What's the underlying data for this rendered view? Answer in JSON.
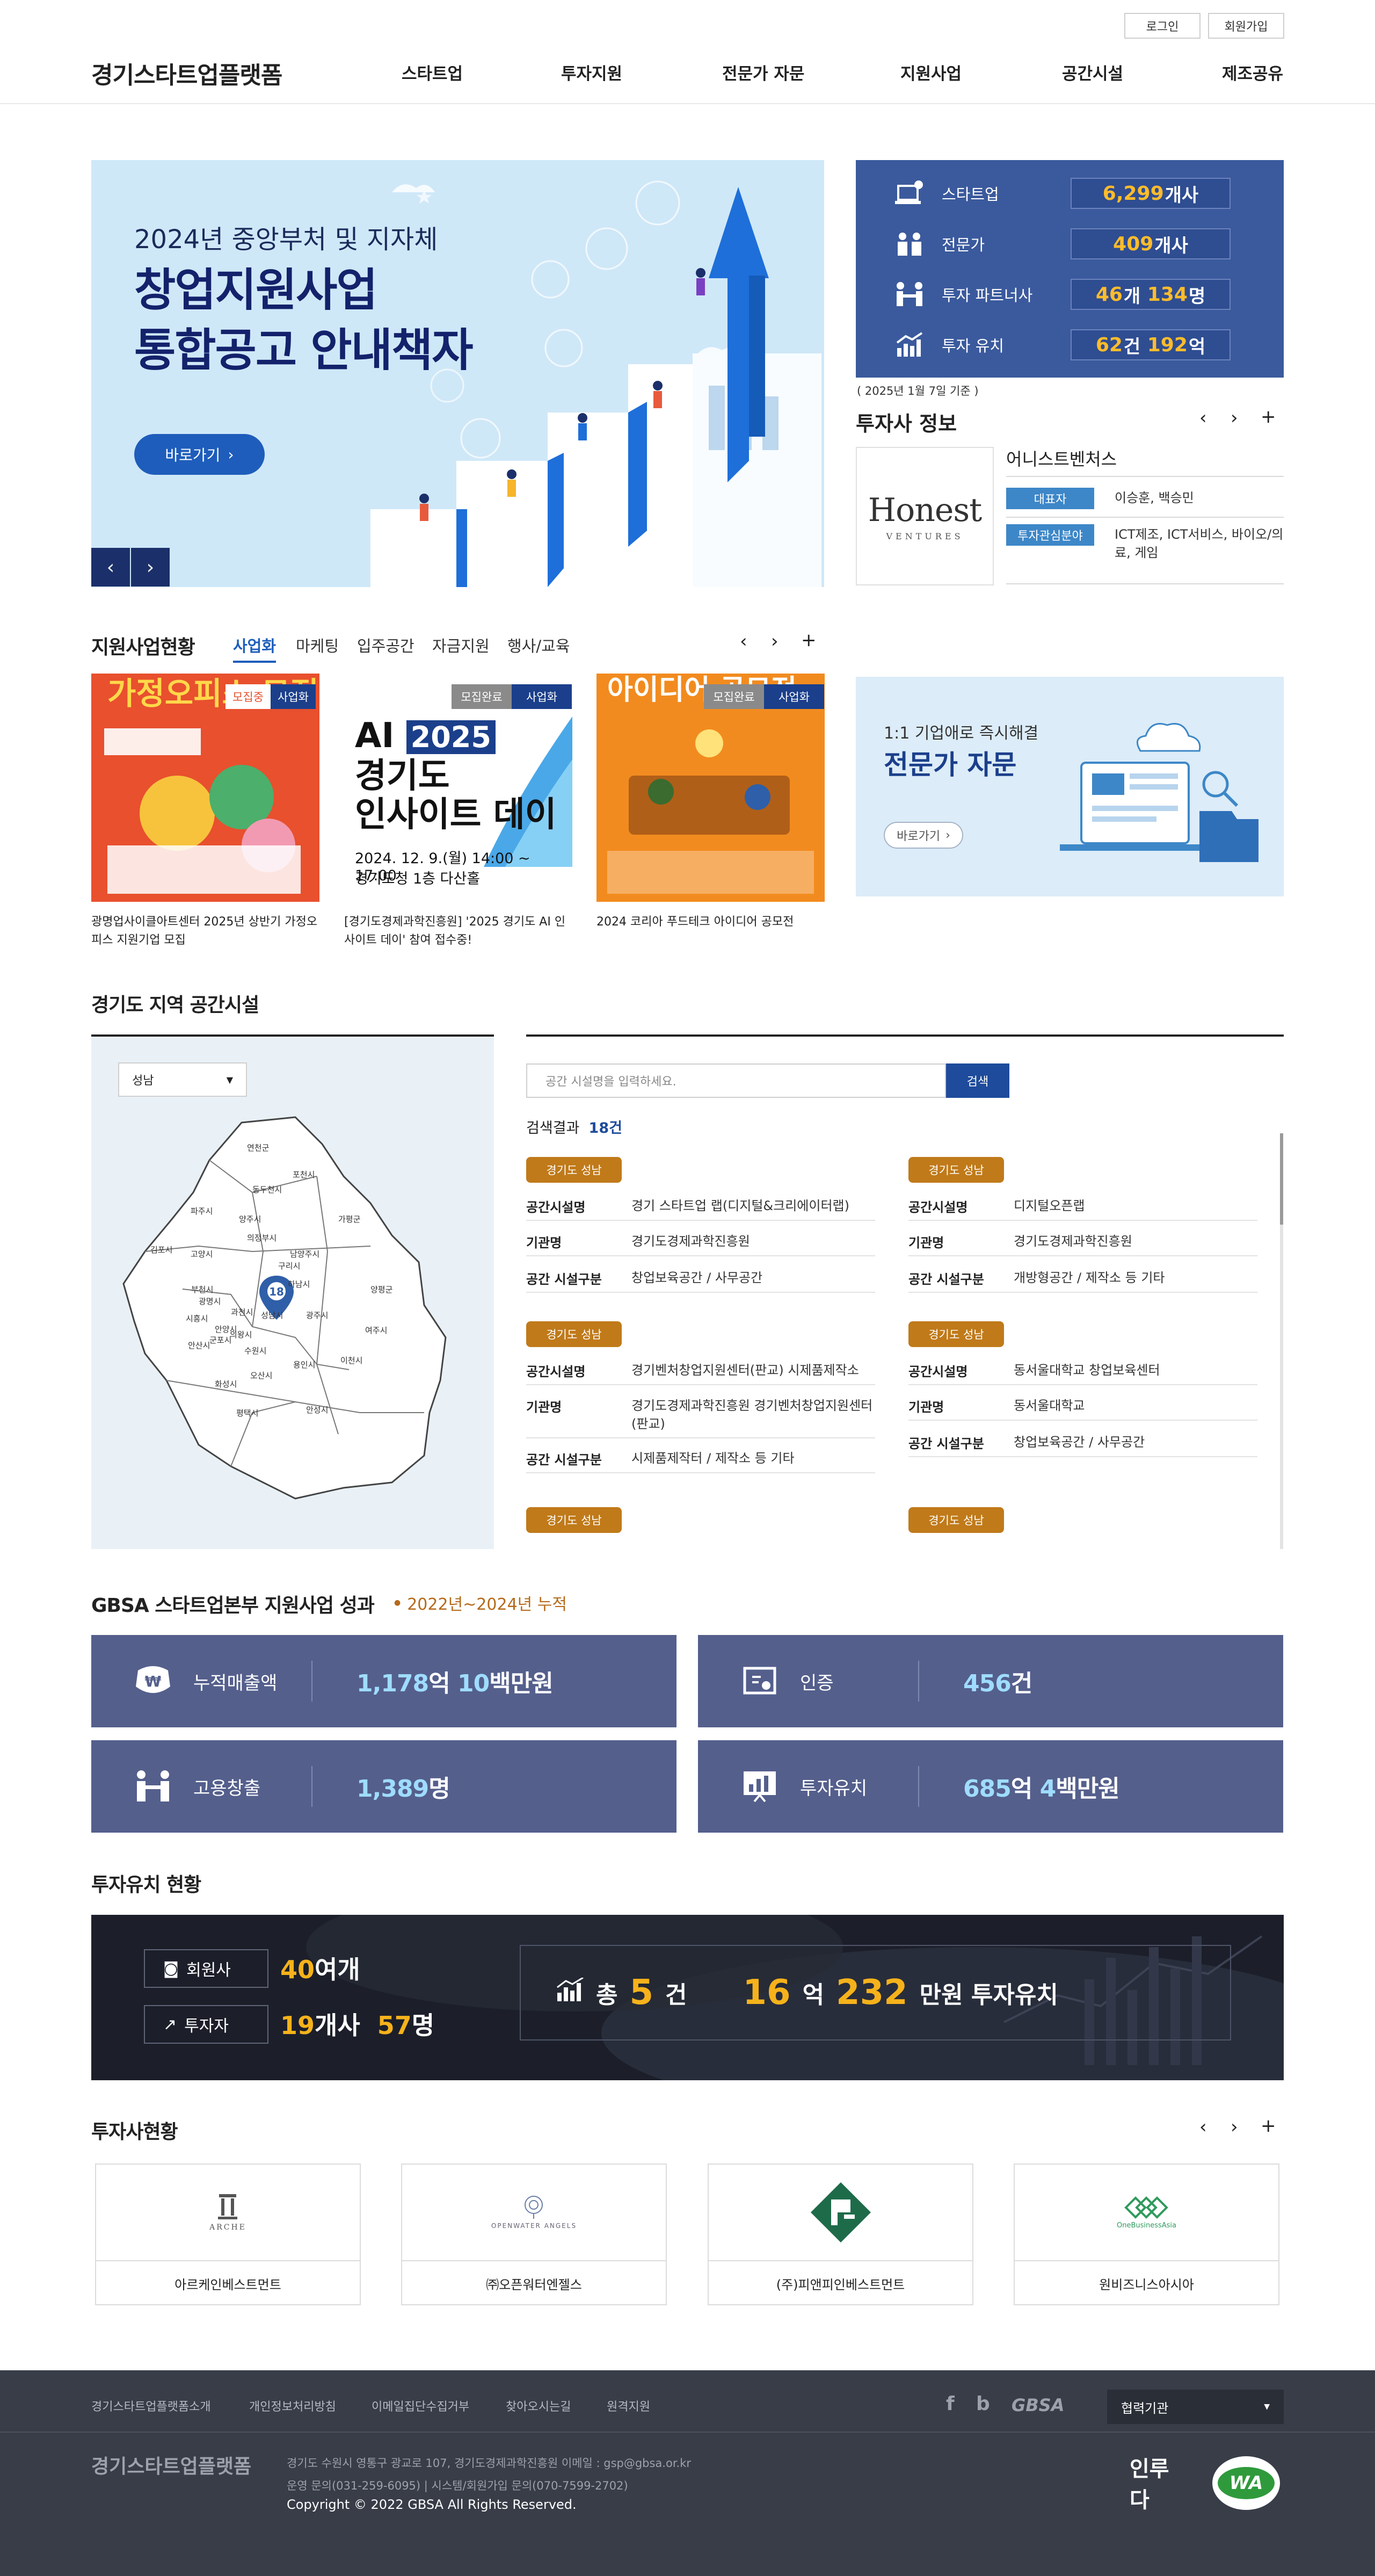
{
  "header": {
    "logo": "경기스타트업플랫폼",
    "login": "로그인",
    "join": "회원가입",
    "nav": [
      "스타트업",
      "투자지원",
      "전문가 자문",
      "지원사업",
      "공간시설",
      "제조공유"
    ]
  },
  "hero": {
    "subtitle": "2024년 중앙부처 및 지자체",
    "title_line1": "창업지원사업",
    "title_line2": "통합공고 안내책자",
    "button": "바로가기",
    "prev": "‹",
    "next": "›"
  },
  "stats": {
    "items": [
      {
        "label": "스타트업",
        "v1": "6,299",
        "u1": "개사",
        "icon": "startup-icon"
      },
      {
        "label": "전문가",
        "v1": "409",
        "u1": "개사",
        "icon": "expert-icon"
      },
      {
        "label": "투자 파트너사",
        "v1": "46",
        "u1": "개",
        "v2": "134",
        "u2": "명",
        "icon": "partner-icon"
      },
      {
        "label": "투자 유치",
        "v1": "62",
        "u1": "건",
        "v2": "192",
        "u2": "억",
        "icon": "investment-icon"
      }
    ],
    "note": "( 2025년 1월 7일 기준 )"
  },
  "investor_info": {
    "title": "투자사 정보",
    "logo_text": "Honest",
    "logo_sub": "VENTURES",
    "name": "어니스트벤처스",
    "ceo_label": "대표자",
    "ceo": "이승훈, 백승민",
    "field_label": "투자관심분야",
    "field": "ICT제조, ICT서비스, 바이오/의료, 게임"
  },
  "controls": {
    "prev": "‹",
    "next": "›",
    "more": "+"
  },
  "support": {
    "title": "지원사업현황",
    "tabs": [
      "사업화",
      "마케팅",
      "입주공간",
      "자금지원",
      "행사/교육"
    ],
    "cards": [
      {
        "img_title": "가정오피스 모집",
        "status": "모집중",
        "category": "사업화",
        "caption": "광명업사이클아트센터 2025년 상반기 가정오피스 지원기업 모집"
      },
      {
        "img_title_1": "AI",
        "img_title_2": "2025",
        "img_title_3": "경기도",
        "img_title_4": "인사이트 데이",
        "img_date": "2024. 12. 9.(월) 14:00 ~ 17:00",
        "img_place": "경기도청 1층 다산홀",
        "status": "모집완료",
        "category": "사업화",
        "caption": "[경기도경제과학진흥원] '2025 경기도 AI 인사이트 데이' 참여 접수중!"
      },
      {
        "img_title": "아이디어 공모전",
        "status": "모집완료",
        "category": "사업화",
        "caption": "2024 코리아 푸드테크 아이디어 공모전"
      }
    ],
    "expert": {
      "sub": "1:1 기업애로 즉시해결",
      "title": "전문가 자문",
      "button": "바로가기"
    }
  },
  "space": {
    "title": "경기도 지역 공간시설",
    "region_select": "성남",
    "map_count": "18",
    "map_labels": [
      "연천군",
      "포천시",
      "파주시",
      "동두천시",
      "양주시",
      "가평군",
      "의정부시",
      "고양시",
      "남양주시",
      "김포시",
      "구리시",
      "양평군",
      "하남시",
      "광명시",
      "과천시",
      "성남시",
      "시흥시",
      "안양시",
      "광주시",
      "의왕시",
      "여주시",
      "군포시",
      "안산시",
      "수원시",
      "용인시",
      "이천시",
      "오산시",
      "화성시",
      "평택시",
      "안성시",
      "부천시"
    ],
    "search_placeholder": "공간 시설명을 입력하세요.",
    "search_button": "검색",
    "result_label": "검색결과",
    "result_count": "18건",
    "key_name": "공간시설명",
    "key_org": "기관명",
    "key_type": "공간 시설구분",
    "results": [
      {
        "region": "경기도 성남",
        "name": "경기 스타트업 랩(디지털&크리에이터랩)",
        "org": "경기도경제과학진흥원",
        "type": "창업보육공간 / 사무공간"
      },
      {
        "region": "경기도 성남",
        "name": "디지털오픈랩",
        "org": "경기도경제과학진흥원",
        "type": "개방형공간 / 제작소 등 기타"
      },
      {
        "region": "경기도 성남",
        "name": "경기벤처창업지원센터(판교) 시제품제작소",
        "org": "경기도경제과학진흥원 경기벤처창업지원센터(판교)",
        "type": "시제품제작터 / 제작소 등 기타"
      },
      {
        "region": "경기도 성남",
        "name": "동서울대학교 창업보육센터",
        "org": "동서울대학교",
        "type": "창업보육공간 / 사무공간"
      },
      {
        "region": "경기도 성남"
      },
      {
        "region": "경기도 성남"
      }
    ]
  },
  "gbsa": {
    "title": "GBSA 스타트업본부 지원사업 성과",
    "period": "2022년~2024년 누적",
    "cards": [
      {
        "label": "누적매출액",
        "n1": "1,178",
        "u1": "억 ",
        "n2": "10",
        "u2": "백만원",
        "icon": "won-icon"
      },
      {
        "label": "인증",
        "n1": "456",
        "u1": "건",
        "icon": "certificate-icon"
      },
      {
        "label": "고용창출",
        "n1": "1,389",
        "u1": "명",
        "icon": "people-icon"
      },
      {
        "label": "투자유치",
        "n1": "685",
        "u1": "억 ",
        "n2": "4",
        "u2": "백만원",
        "icon": "chart-board-icon"
      }
    ]
  },
  "invest_status": {
    "title": "투자유치 현황",
    "member_label": "회원사",
    "member_n": "40",
    "member_u": "여개",
    "investor_label": "투자자",
    "investor_n1": "19",
    "investor_u1": "개사",
    "investor_n2": "57",
    "investor_u2": "명",
    "total_prefix": "총",
    "total_n": "5",
    "total_u": "건",
    "amount_n1": "16",
    "amount_u1": "억",
    "amount_n2": "232",
    "amount_u2": "만원 투자유치"
  },
  "vc_list": {
    "title": "투자사현황",
    "items": [
      {
        "name": "아르케인베스트먼트",
        "logo_text": "ARCHE"
      },
      {
        "name": "㈜오픈워터엔젤스",
        "logo_text": "OPENWATER ANGELS"
      },
      {
        "name": "(주)피앤피인베스트먼트",
        "logo_text": "P&P"
      },
      {
        "name": "원비즈니스아시아",
        "logo_text": "OneBusinessAsia"
      }
    ]
  },
  "footer": {
    "links": [
      "경기스타트업플랫폼소개",
      "개인정보처리방침",
      "이메일집단수집거부",
      "찾아오시는길",
      "원격지원"
    ],
    "partner_select": "협력기관",
    "brand": "GBSA",
    "logo": "경기스타트업플랫폼",
    "address": "경기도 수원시 영통구 광교로 107, 경기도경제과학진흥원 이메일 : gsp@gbsa.or.kr",
    "contact": "운영 문의(031-259-6095) | 시스템/회원가입 문의(070-7599-2702)",
    "copyright": "Copyright © 2022 GBSA All Rights Reserved.",
    "cert1": "인루다",
    "cert2": "WA"
  }
}
